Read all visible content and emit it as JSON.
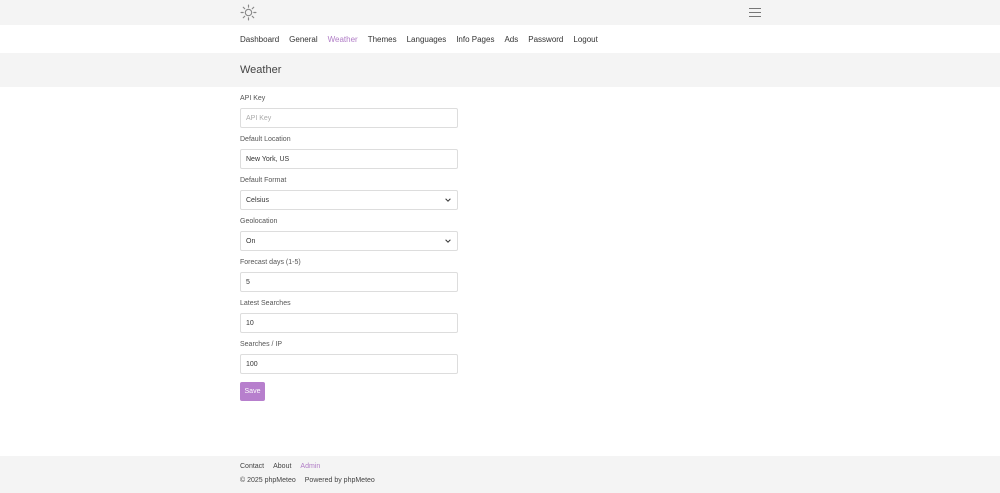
{
  "header": {
    "logo_icon": "sun-icon",
    "menu_icon": "hamburger-icon"
  },
  "nav": {
    "items": [
      {
        "label": "Dashboard"
      },
      {
        "label": "General"
      },
      {
        "label": "Weather",
        "active": true
      },
      {
        "label": "Themes"
      },
      {
        "label": "Languages"
      },
      {
        "label": "Info Pages"
      },
      {
        "label": "Ads"
      },
      {
        "label": "Password"
      },
      {
        "label": "Logout"
      }
    ]
  },
  "page": {
    "title": "Weather"
  },
  "form": {
    "api_key": {
      "label": "API Key",
      "value": "",
      "placeholder": "API Key"
    },
    "default_location": {
      "label": "Default Location",
      "value": "New York, US"
    },
    "default_format": {
      "label": "Default Format",
      "value": "Celsius"
    },
    "geolocation": {
      "label": "Geolocation",
      "value": "On"
    },
    "forecast_days": {
      "label": "Forecast days (1-5)",
      "value": "5"
    },
    "latest_searches": {
      "label": "Latest Searches",
      "value": "10"
    },
    "searches_ip": {
      "label": "Searches / IP",
      "value": "100"
    },
    "save_label": "Save"
  },
  "footer": {
    "links": [
      {
        "label": "Contact"
      },
      {
        "label": "About"
      },
      {
        "label": "Admin",
        "accent": true
      }
    ],
    "copyright": "© 2025 phpMeteo",
    "powered": "Powered by phpMeteo"
  },
  "colors": {
    "accent": "#b07cc6",
    "button": "#b77fcd",
    "bar_bg": "#f4f4f4"
  }
}
